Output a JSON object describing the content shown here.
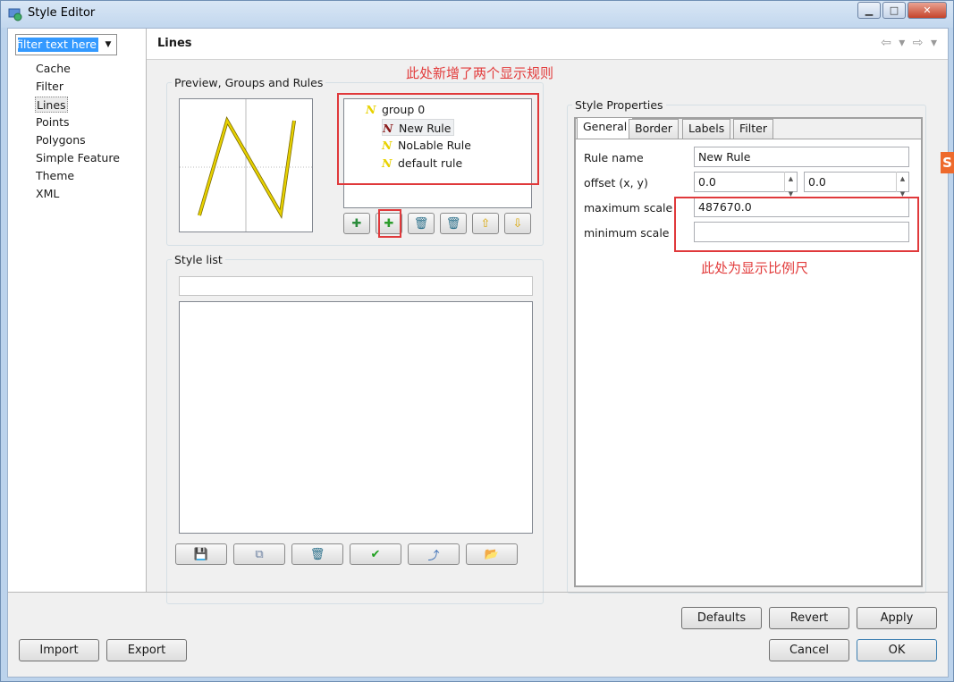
{
  "window": {
    "title": "Style Editor",
    "controls": {
      "minimize": "▁",
      "maximize": "□",
      "close": "✕"
    }
  },
  "filter": {
    "text": "e filter text here"
  },
  "nav": {
    "items": [
      "Cache",
      "Filter",
      "Lines",
      "Points",
      "Polygons",
      "Simple Feature",
      "Theme",
      "XML"
    ],
    "selected": "Lines"
  },
  "page": {
    "title": "Lines",
    "back": "⇦",
    "forward": "⇨"
  },
  "preview_group": {
    "legend": "Preview, Groups and Rules",
    "tree": [
      {
        "label": "group 0",
        "icon": "line-symbol-icon",
        "glyph": "N"
      },
      {
        "label": "New Rule",
        "icon": "line-symbol-red-icon",
        "glyph": "N"
      },
      {
        "label": "NoLable Rule",
        "icon": "line-symbol-icon",
        "glyph": "N"
      },
      {
        "label": "default rule",
        "icon": "line-symbol-icon",
        "glyph": "N"
      }
    ],
    "annotation": "此处新增了两个显示规则",
    "toolbar": [
      "add-group-icon",
      "add-rule-icon",
      "delete-icon",
      "delete-all-icon",
      "move-up-icon",
      "move-down-icon"
    ]
  },
  "style_list": {
    "legend": "Style list",
    "filter_value": "",
    "items": []
  },
  "style_properties": {
    "legend": "Style Properties",
    "tabs": [
      "General",
      "Border",
      "Labels",
      "Filter"
    ],
    "active_tab": "General",
    "fields": {
      "rule_name_label": "Rule name",
      "rule_name_value": "New Rule",
      "offset_label": "offset (x, y)",
      "offset_x": "0.0",
      "offset_y": "0.0",
      "max_scale_label": "maximum scale",
      "max_scale_value": "487670.0",
      "min_scale_label": "minimum scale",
      "min_scale_value": ""
    },
    "annotation": "此处为显示比例尺"
  },
  "buttons": {
    "defaults": "Defaults",
    "revert": "Revert",
    "apply": "Apply",
    "import": "Import",
    "export": "Export",
    "cancel": "Cancel",
    "ok": "OK"
  },
  "colors": {
    "accent": "#3399ff",
    "annotation": "#e0393b",
    "line_symbol": "#e8d200"
  }
}
